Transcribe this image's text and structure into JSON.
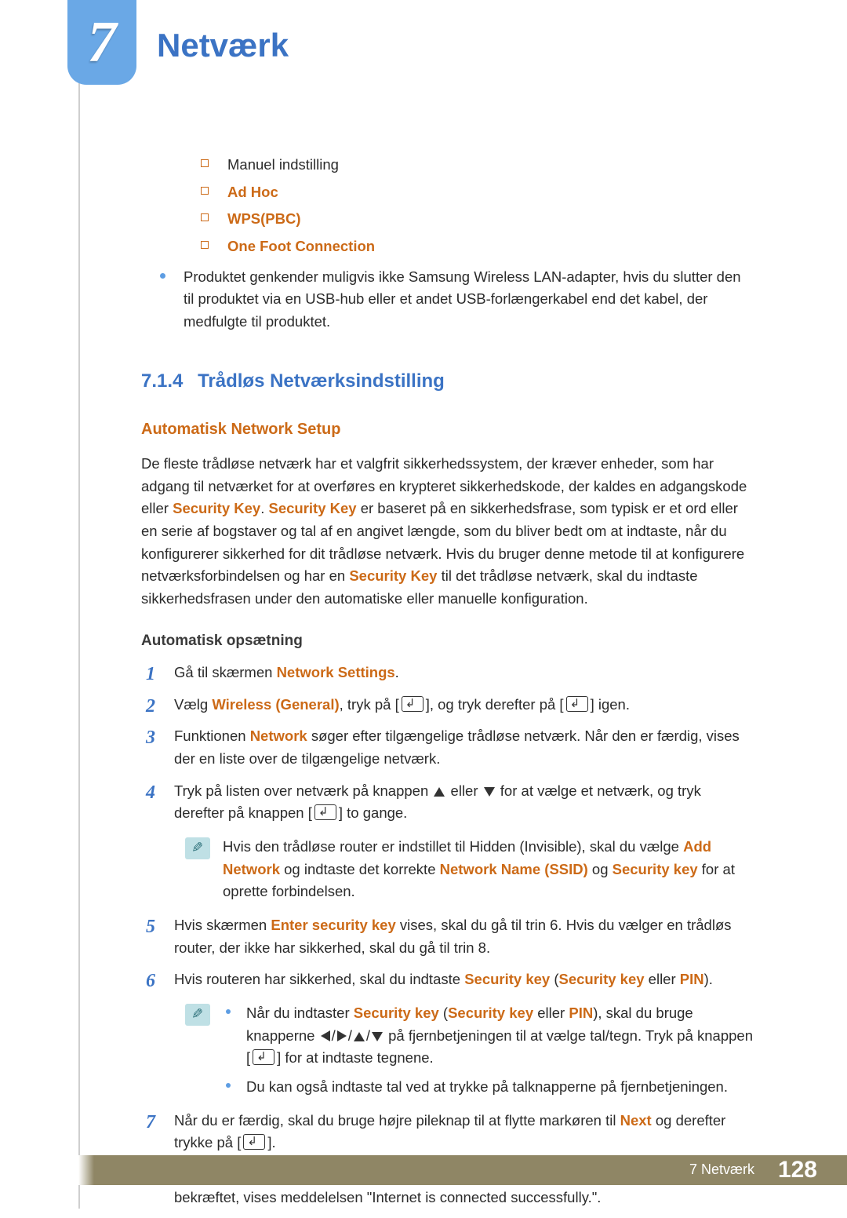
{
  "header": {
    "chapter_num": "7",
    "chapter_title": "Netværk"
  },
  "top_list": [
    "Manuel indstilling",
    "Ad Hoc",
    "WPS(PBC)",
    "One Foot Connection"
  ],
  "dot_note": "Produktet genkender muligvis ikke Samsung Wireless LAN-adapter, hvis du slutter den til produktet via en USB-hub eller et andet USB-forlængerkabel end det kabel, der medfulgte til produktet.",
  "section": {
    "number": "7.1.4",
    "title": "Trådløs Netværksindstilling",
    "subhead": "Automatisk Network Setup",
    "subhead2": "Automatisk opsætning"
  },
  "intro": {
    "p1a": "De fleste trådløse netværk har et valgfrit sikkerhedssystem, der kræver enheder, som har adgang til netværket for at overføres en krypteret sikkerhedskode, der kaldes en adgangskode eller ",
    "sk": "Security Key",
    "dot": ". ",
    "p1b": " er baseret på en sikkerhedsfrase, som typisk er et ord eller en serie af bogstaver og tal af en angivet længde, som du bliver bedt om at indtaste, når du konfigurerer sikkerhed for dit trådløse netværk. Hvis du bruger denne metode til at konfigurere netværksforbindelsen og har en ",
    "p1c": " til det trådløse netværk, skal du indtaste sikkerhedsfrasen under den automatiske eller manuelle konfiguration."
  },
  "steps": {
    "dot": ".",
    "s1a": "Gå til skærmen ",
    "s1b": "Network Settings",
    "s2a": "Vælg ",
    "s2b": "Wireless (General)",
    "s2c": ", tryk på ",
    "s2d": ", og tryk derefter på ",
    "s2e": " igen.",
    "s3a": "Funktionen ",
    "s3b": "Network",
    "s3c": " søger efter tilgængelige trådløse netværk. Når den er færdig, vises der en liste over de tilgængelige netværk.",
    "s4a": "Tryk på listen over netværk på knappen ",
    "s4b": " eller ",
    "s4c": " for at vælge et netværk, og tryk derefter på knappen ",
    "s4d": " to gange.",
    "note4a": "Hvis den trådløse router er indstillet til Hidden (Invisible), skal du vælge ",
    "note4b": "Add Network",
    "note4c": " og indtaste det korrekte ",
    "note4d": "Network Name (SSID)",
    "note4e": " og ",
    "note4f": "Security key",
    "note4g": " for at oprette forbindelsen.",
    "s5a": "Hvis skærmen ",
    "s5b": "Enter security key",
    "s5c": " vises, skal du gå til trin 6. Hvis du vælger en trådløs router, der ikke har sikkerhed, skal du gå til trin 8.",
    "s6a": "Hvis routeren har sikkerhed, skal du indtaste ",
    "s6b": "Security key",
    "s6p1": " (",
    "s6c": " eller ",
    "s6d": "PIN",
    "s6p2": ").",
    "note6a": "Når du indtaster ",
    "note6b": "), skal du bruge knapperne ",
    "note6c": " på fjernbetjeningen til at vælge tal/tegn. Tryk på knappen ",
    "note6d": " for at indtaste tegnene.",
    "note6e": "Du kan også indtaste tal ved at trykke på talknapperne på fjernbetjeningen.",
    "s7a": "Når du er færdig, skal du bruge højre pileknap til at flytte markøren til ",
    "s7b": "Next",
    "s7c": " og derefter trykke på ",
    "s8": "Netværksforbindelsessskærmen vises, og bekræftelsen starter. Når forbindelsen er bekræftet, vises meddelelsen \"Internet is connected successfully.\"."
  },
  "footer": {
    "text": "7 Netværk",
    "page": "128"
  }
}
